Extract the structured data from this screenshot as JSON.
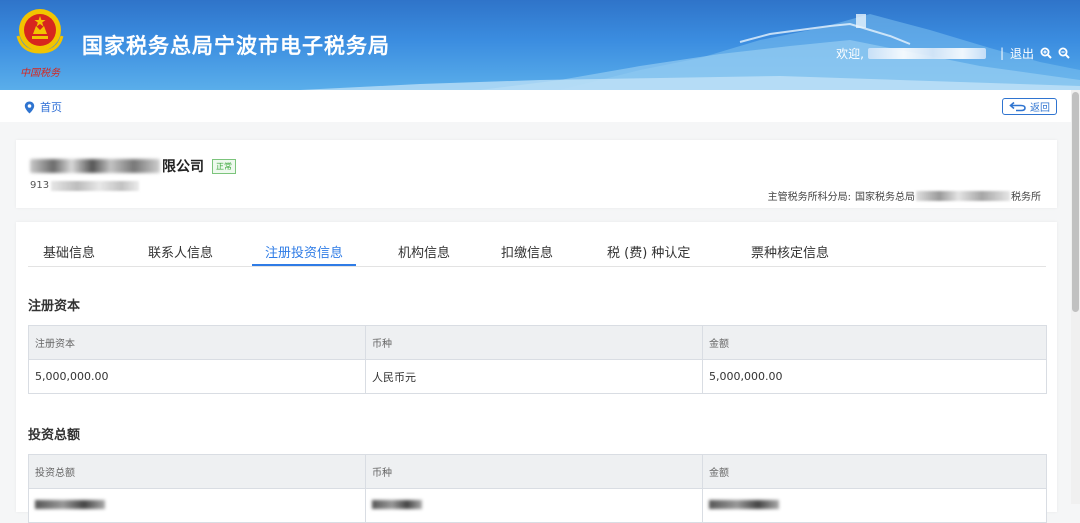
{
  "header": {
    "title": "国家税务总局宁波市电子税务局",
    "welcome": "欢迎,",
    "separator": "|",
    "logout": "退出",
    "emblem_text": "中国税务",
    "zoom_in_icon": "zoom-in-icon",
    "zoom_out_icon": "zoom-out-icon"
  },
  "breadcrumb": {
    "home": "首页",
    "icon": "location-pin-icon"
  },
  "back_button": {
    "label": "返回",
    "icon": "return-arrow-icon"
  },
  "company": {
    "name_suffix": "限公司",
    "status": "正常",
    "tax_id_prefix": "913",
    "office_label": "主管税务所科分局:",
    "office_prefix": "国家税务总局",
    "office_suffix": "税务所"
  },
  "tabs": [
    {
      "label": "基础信息",
      "active": false
    },
    {
      "label": "联系人信息",
      "active": false
    },
    {
      "label": "注册投资信息",
      "active": true
    },
    {
      "label": "机构信息",
      "active": false
    },
    {
      "label": "扣缴信息",
      "active": false
    },
    {
      "label": "税 (费) 种认定",
      "active": false
    },
    {
      "label": "票种核定信息",
      "active": false
    }
  ],
  "registered_capital": {
    "title": "注册资本",
    "headers": [
      "注册资本",
      "币种",
      "金额"
    ],
    "rows": [
      [
        "5,000,000.00",
        "人民币元",
        "5,000,000.00"
      ]
    ]
  },
  "total_investment": {
    "title": "投资总额",
    "headers": [
      "投资总额",
      "币种",
      "金额"
    ]
  },
  "colors": {
    "header_blue": "#3b8de0",
    "accent_blue": "#2f7ce6",
    "status_green": "#3aa53a",
    "table_header_bg": "#eef0f2"
  }
}
